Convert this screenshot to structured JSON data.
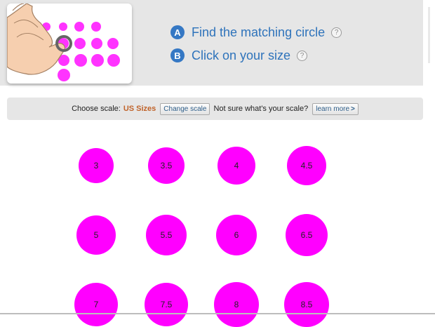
{
  "instructions": {
    "step_a": {
      "badge": "A",
      "text": "Find the matching circle",
      "help": "?"
    },
    "step_b": {
      "badge": "B",
      "text": "Click on your size",
      "help": "?"
    }
  },
  "scale_bar": {
    "choose_label": "Choose scale:",
    "scale_value": "US Sizes",
    "change_button": "Change scale",
    "question": "Not sure what's your scale?",
    "learn_more": "learn more",
    "learn_more_arrow": ">"
  },
  "sizes": [
    "3",
    "3.5",
    "4",
    "4.5",
    "5",
    "5.5",
    "6",
    "6.5",
    "7",
    "7.5",
    "8",
    "8.5"
  ],
  "colors": {
    "circle": "#ff00ff",
    "step_text": "#2e73bb",
    "badge": "#3578c4",
    "scale_value": "#c0632a"
  }
}
